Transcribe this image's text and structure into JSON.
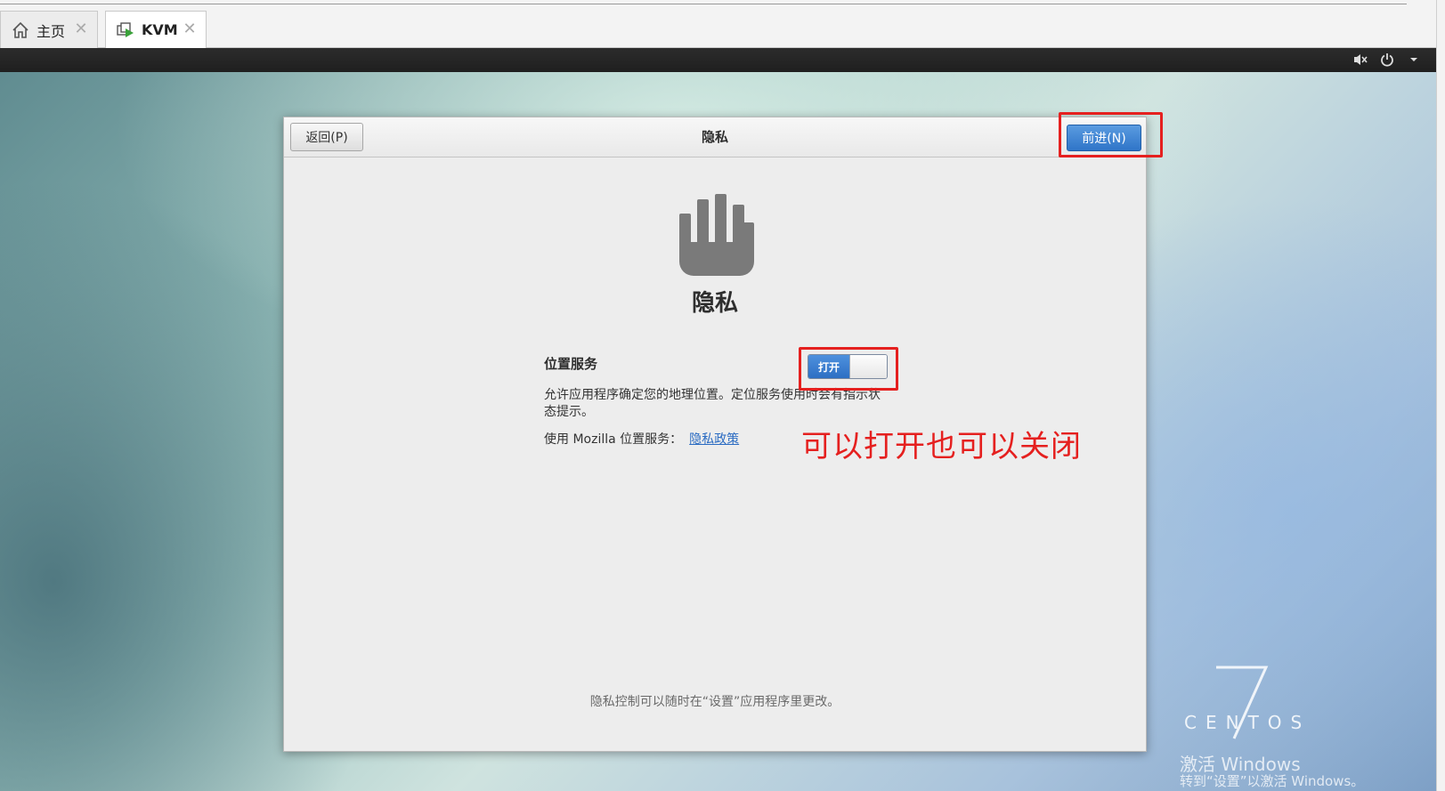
{
  "tabs": [
    {
      "label": "主页",
      "icon": "home-icon"
    },
    {
      "label": "KVM",
      "icon": "vm-icon"
    }
  ],
  "system_tray": {
    "icons": [
      "volume-muted-icon",
      "power-icon",
      "chevron-down-icon"
    ]
  },
  "dialog": {
    "back_label": "返回(P)",
    "header_title": "隐私",
    "next_label": "前进(N)",
    "icon": "privacy-hand-icon",
    "big_title": "隐私",
    "location_service": {
      "label": "位置服务",
      "toggle_label": "打开",
      "toggle_on": true,
      "description": "允许应用程序确定您的地理位置。定位服务使用时会有指示状态提示。",
      "mozilla_text": "使用  Mozilla 位置服务：",
      "policy_link": "隐私政策"
    },
    "footer_note": "隐私控制可以随时在“设置”应用程序里更改。"
  },
  "annotation": {
    "text": "可以打开也可以关闭",
    "color": "#e5201f"
  },
  "branding": {
    "version": "7",
    "name": "CENTOS"
  },
  "watermark": {
    "line1": "激活 Windows",
    "line2": "转到“设置”以激活 Windows。"
  },
  "colors": {
    "accent": "#2f75c8",
    "annotation": "#e5201f",
    "link": "#2a6bc2"
  }
}
